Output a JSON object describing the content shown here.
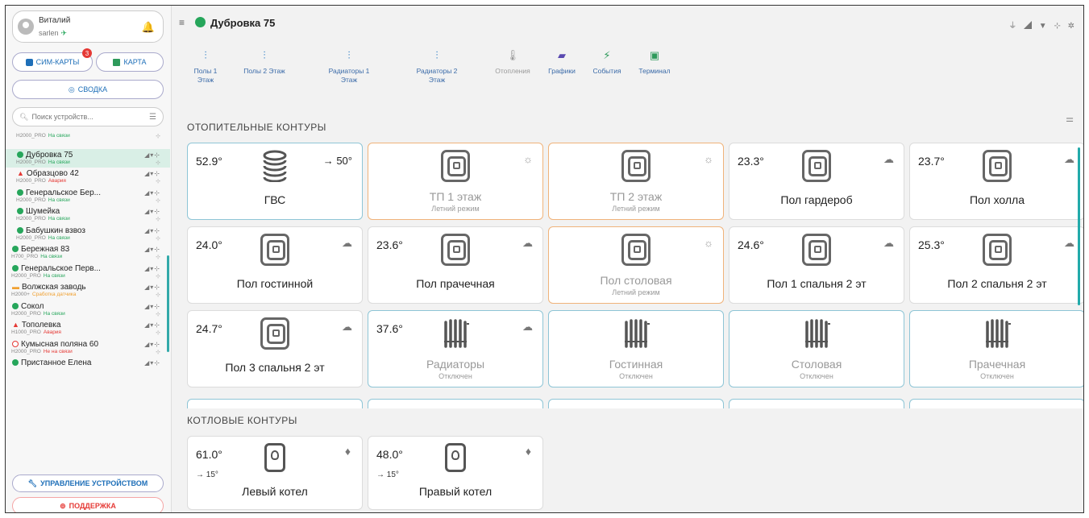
{
  "user": {
    "name": "Виталий",
    "login": "sarlen"
  },
  "sidebar": {
    "sim_label": "СИМ-КАРТЫ",
    "sim_badge": "3",
    "map_label": "КАРТА",
    "summary_label": "СВОДКА",
    "search_placeholder": "Поиск устройств...",
    "manage_label": "УПРАВЛЕНИЕ УСТРОЙСТВОМ",
    "support_label": "ПОДДЕРЖКА",
    "devices": [
      {
        "name": "",
        "model": "H2000_PRO",
        "status": "На связи",
        "state": "ok",
        "indent": true
      },
      {
        "name": "Дубровка 75",
        "model": "H2000_PRO",
        "status": "На связи",
        "state": "ok",
        "indent": true,
        "selected": true
      },
      {
        "name": "Образцово 42",
        "model": "H2000_PRO",
        "status": "Авария",
        "state": "alarm",
        "indent": true
      },
      {
        "name": "Генеральское Бер...",
        "model": "H2000_PRO",
        "status": "На связи",
        "state": "ok",
        "indent": true
      },
      {
        "name": "Шумейка",
        "model": "H2000_PRO",
        "status": "На связи",
        "state": "ok",
        "indent": true
      },
      {
        "name": "Бабушкин взвоз",
        "model": "H2000_PRO",
        "status": "На связи",
        "state": "ok",
        "indent": true
      },
      {
        "name": "Бережная 83",
        "model": "H700_PRO",
        "status": "На связи",
        "state": "ok",
        "indent": false
      },
      {
        "name": "Генеральское Перв...",
        "model": "H2000_PRO",
        "status": "На связи",
        "state": "ok",
        "indent": false
      },
      {
        "name": "Волжская заводь",
        "model": "H2000+",
        "status": "Сработка датчика",
        "state": "warn",
        "indent": false
      },
      {
        "name": "Сокол",
        "model": "H2000_PRO",
        "status": "На связи",
        "state": "ok",
        "indent": false
      },
      {
        "name": "Тополевка",
        "model": "H1000_PRO",
        "status": "Авария",
        "state": "alarm",
        "indent": false
      },
      {
        "name": "Кумысная поляна 60",
        "model": "H2000_PRO",
        "status": "Не на связи",
        "state": "offline",
        "indent": false
      },
      {
        "name": "Пристанное Елена",
        "model": "",
        "status": "",
        "state": "ok",
        "indent": false
      }
    ]
  },
  "header": {
    "title": "Дубровка 75"
  },
  "tabs": [
    {
      "label": "Полы 1 Этаж"
    },
    {
      "label": "Полы 2 Этаж"
    },
    {
      "label": "Радиаторы 1 Этаж"
    },
    {
      "label": "Радиаторы 2 Этаж"
    },
    {
      "label": "Отопления"
    },
    {
      "label": "Графики"
    },
    {
      "label": "События"
    },
    {
      "label": "Терминал"
    }
  ],
  "sections": {
    "heating": "ОТОПИТЕЛЬНЫЕ КОНТУРЫ",
    "boiler": "КОТЛОВЫЕ КОНТУРЫ"
  },
  "heating_cards": [
    {
      "temp": "52.9°",
      "setpoint": "→ 50°",
      "name": "ГВС",
      "status": "",
      "icon": "coil",
      "style": "blue",
      "weather": ""
    },
    {
      "temp": "",
      "setpoint": "",
      "name": "ТП 1 этаж",
      "status": "Летний режим",
      "icon": "floor",
      "style": "orange",
      "weather": "sun"
    },
    {
      "temp": "",
      "setpoint": "",
      "name": "ТП 2 этаж",
      "status": "Летний режим",
      "icon": "floor",
      "style": "orange",
      "weather": "sun"
    },
    {
      "temp": "23.3°",
      "setpoint": "",
      "name": "Пол гардероб",
      "status": "",
      "icon": "floor",
      "style": "plain",
      "weather": "cloud"
    },
    {
      "temp": "23.7°",
      "setpoint": "",
      "name": "Пол холла",
      "status": "",
      "icon": "floor",
      "style": "plain",
      "weather": "cloud"
    },
    {
      "temp": "24.0°",
      "setpoint": "",
      "name": "Пол гостинной",
      "status": "",
      "icon": "floor",
      "style": "plain",
      "weather": "cloud"
    },
    {
      "temp": "23.6°",
      "setpoint": "",
      "name": "Пол прачечная",
      "status": "",
      "icon": "floor",
      "style": "plain",
      "weather": "cloud"
    },
    {
      "temp": "",
      "setpoint": "",
      "name": "Пол столовая",
      "status": "Летний режим",
      "icon": "floor",
      "style": "orange",
      "weather": "sun"
    },
    {
      "temp": "24.6°",
      "setpoint": "",
      "name": "Пол 1 спальня 2 эт",
      "status": "",
      "icon": "floor",
      "style": "plain",
      "weather": "cloud"
    },
    {
      "temp": "25.3°",
      "setpoint": "",
      "name": "Пол 2 спальня 2 эт",
      "status": "",
      "icon": "floor",
      "style": "plain",
      "weather": "cloud"
    },
    {
      "temp": "24.7°",
      "setpoint": "",
      "name": "Пол 3 спальня 2 эт",
      "status": "",
      "icon": "floor",
      "style": "plain",
      "weather": "cloud"
    },
    {
      "temp": "37.6°",
      "setpoint": "",
      "name": "Радиаторы",
      "status": "Отключен",
      "icon": "radiator",
      "style": "blue",
      "weather": "cloud"
    },
    {
      "temp": "",
      "setpoint": "",
      "name": "Гостинная",
      "status": "Отключен",
      "icon": "radiator",
      "style": "blue",
      "weather": ""
    },
    {
      "temp": "",
      "setpoint": "",
      "name": "Столовая",
      "status": "Отключен",
      "icon": "radiator",
      "style": "blue",
      "weather": ""
    },
    {
      "temp": "",
      "setpoint": "",
      "name": "Прачечная",
      "status": "Отключен",
      "icon": "radiator",
      "style": "blue",
      "weather": ""
    }
  ],
  "boiler_cards": [
    {
      "temp": "61.0°",
      "setpoint": "→ 15°",
      "name": "Левый котел"
    },
    {
      "temp": "48.0°",
      "setpoint": "→ 15°",
      "name": "Правый котел"
    }
  ],
  "colors": {
    "ok": "#26a65b",
    "alarm": "#e53935",
    "warn": "#f0a030",
    "offline": "#e53935",
    "accent": "#1e6fb8"
  }
}
